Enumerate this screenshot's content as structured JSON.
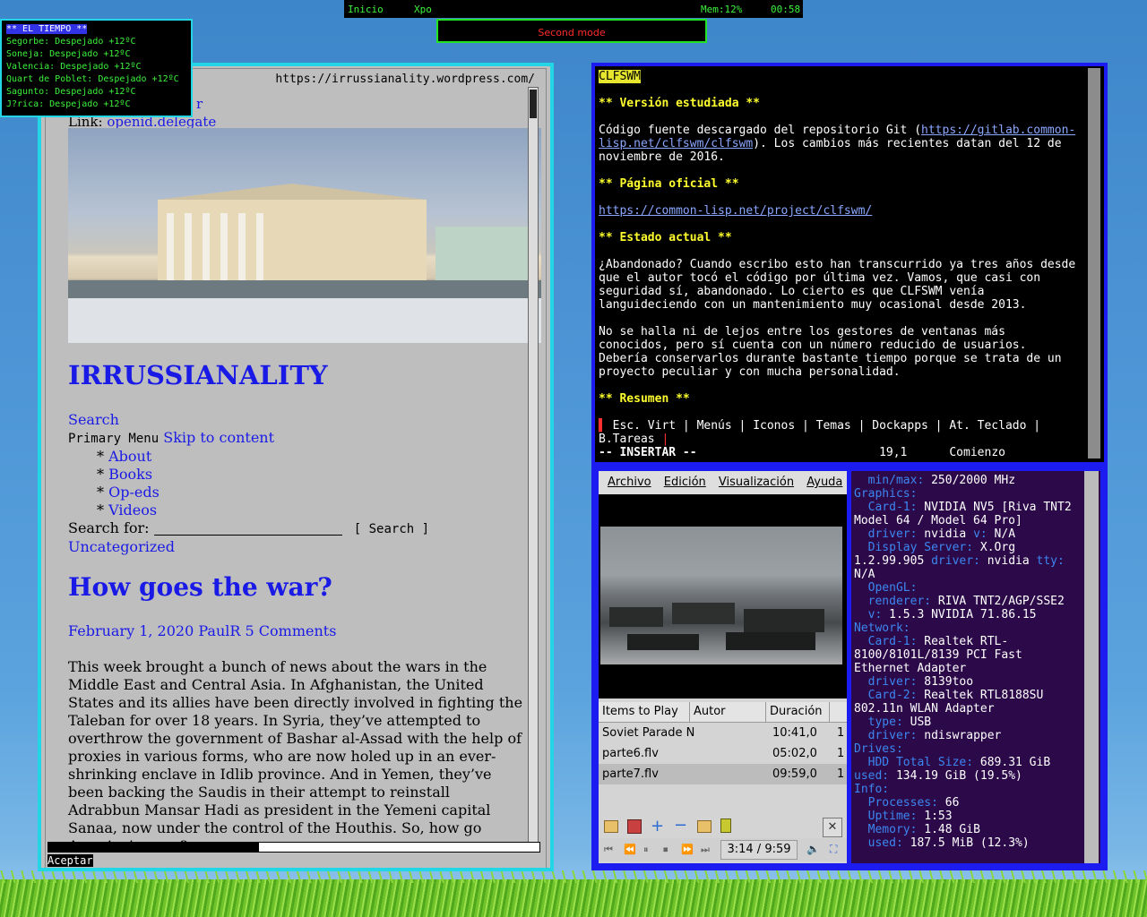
{
  "topbar": {
    "inicio": "Inicio",
    "xpo": "Xpo",
    "mem": "Mem:12%",
    "time": "00:58"
  },
  "mode": "Second mode",
  "weather": {
    "title": "** EL TIEMPO **",
    "lines": [
      "Segorbe: Despejado  +12ºC",
      "Soneja: Despejado  +12ºC",
      "Valencia: Despejado  +12ºC",
      "Quart de Poblet: Despejado  +12ºC",
      "Sagunto: Despejado  +12ºC",
      "J?rica: Despejado  +12ºC"
    ]
  },
  "browser": {
    "url": "https://irrussianality.wordpress.com/",
    "hidden_line1_tail": "r",
    "link_label": "Link:",
    "link_value": "openid.delegate",
    "site_title": "IRRUSSIANALITY",
    "search": "Search",
    "primary_menu": "Primary Menu",
    "skip": "Skip to content",
    "menu": [
      "About",
      "Books",
      "Op-eds",
      "Videos"
    ],
    "search_for": "Search for:",
    "search_button": "[ Search ]",
    "category": "Uncategorized",
    "post_title": "How goes the war?",
    "post_meta": "February 1, 2020 PaulR 5 Comments",
    "post_body": "This week brought a bunch of news about the wars in the Middle East and Central Asia. In Afghanistan, the United States and its allies have been directly involved in fighting the Taleban for over 18 years. In Syria, they’ve attempted to overthrow the government of Bashar al-Assad with the help of proxies in various forms, who are now holed up in an ever-shrinking enclave in Idlib province. And in Yemen, they’ve been backing the Saudis in their attempt to reinstall Adrabbun Mansar Hadi as president in the Yemeni capital Sanaa, now under the control of the Houthis. So, how go America’s wars?",
    "status": "Aceptar"
  },
  "editor": {
    "tag": "CLFSWM",
    "h1": "** Versión estudiada **",
    "p1a": "Código fuente descargado del repositorio Git (",
    "p1link": "https://gitlab.common-lisp.net/clfswm/clfswm",
    "p1b": "). Los cambios más recientes datan del 12 de noviembre de 2016.",
    "h2": "** Página oficial **",
    "p2link": "https://common-lisp.net/project/clfswm/",
    "h3": "** Estado actual **",
    "p3": "¿Abandonado? Cuando escribo esto han transcurrido ya tres años desde que el autor tocó el código por última vez. Vamos, que casi con seguridad sí, abandonado. Lo cierto es que CLFSWM venía languideciendo con un mantenimiento muy ocasional desde 2013.",
    "p4": "No se halla ni de lejos entre los gestores de ventanas más conocidos, pero sí cuenta con un número reducido de usuarios. Debería conservarlos durante bastante tiempo porque se trata de un proyecto peculiar y con mucha personalidad.",
    "h4": "** Resumen **",
    "tabs": " Esc. Virt | Menús | Iconos | Temas | Dockapps | At. Teclado | B.Tareas ",
    "mode": "-- INSERTAR --",
    "pos": "19,1",
    "where": "Comienzo"
  },
  "player": {
    "menu": [
      "Archivo",
      "Edición",
      "Visualización",
      "Ayuda"
    ],
    "headers": [
      "Items to Play",
      "Autor",
      "Duración"
    ],
    "rows": [
      {
        "title": "Soviet Parade N",
        "dur": "10:41,0",
        "n": "1"
      },
      {
        "title": "parte6.flv",
        "dur": "05:02,0",
        "n": "1"
      },
      {
        "title": "parte7.flv",
        "dur": "09:59,0",
        "n": "1"
      }
    ],
    "current": "3:14 /",
    "total": "9:59"
  },
  "sysinfo": [
    {
      "k": "  min/max:",
      "v": " 250/2000 MHz"
    },
    {
      "k": "Graphics:",
      "v": ""
    },
    {
      "k": "  Card-1:",
      "v": " NVIDIA NV5 [Riva TNT2 Model 64 / Model 64 Pro]"
    },
    {
      "k": "  driver:",
      "v": " nvidia "
    },
    {
      "k": "v:",
      "v": " N/A"
    },
    {
      "k": "  Display Server:",
      "v": " X.Org 1.2.99.905 "
    },
    {
      "k": "driver:",
      "v": " nvidia "
    },
    {
      "k": "tty:",
      "v": " N/A"
    },
    {
      "k": "  OpenGL:",
      "v": ""
    },
    {
      "k": "  renderer:",
      "v": " RIVA TNT2/AGP/SSE2"
    },
    {
      "k": "  v:",
      "v": " 1.5.3 NVIDIA 71.86.15"
    },
    {
      "k": "Network:",
      "v": ""
    },
    {
      "k": "  Card-1:",
      "v": " Realtek RTL-8100/8101L/8139 PCI Fast Ethernet Adapter"
    },
    {
      "k": "  driver:",
      "v": " 8139too"
    },
    {
      "k": "  Card-2:",
      "v": " Realtek RTL8188SU 802.11n WLAN Adapter"
    },
    {
      "k": "  type:",
      "v": " USB"
    },
    {
      "k": "  driver:",
      "v": " ndiswrapper"
    },
    {
      "k": "Drives:",
      "v": ""
    },
    {
      "k": "  HDD Total Size:",
      "v": " 689.31 GiB "
    },
    {
      "k": "used:",
      "v": " 134.19 GiB (19.5%)"
    },
    {
      "k": "Info:",
      "v": ""
    },
    {
      "k": "  Processes:",
      "v": " 66"
    },
    {
      "k": "  Uptime:",
      "v": " 1:53"
    },
    {
      "k": "  Memory:",
      "v": " 1.48 GiB"
    },
    {
      "k": "  used:",
      "v": " 187.5 MiB (12.3%)"
    }
  ],
  "colors": {
    "frame_cyan": "#22d6e6",
    "frame_blue": "#1c1cf0",
    "green": "#3cf23c",
    "link": "#1a1ae6",
    "heading": "#ffff2e",
    "sys_bg": "#2c0a4a",
    "sys_key": "#3c86f0"
  }
}
